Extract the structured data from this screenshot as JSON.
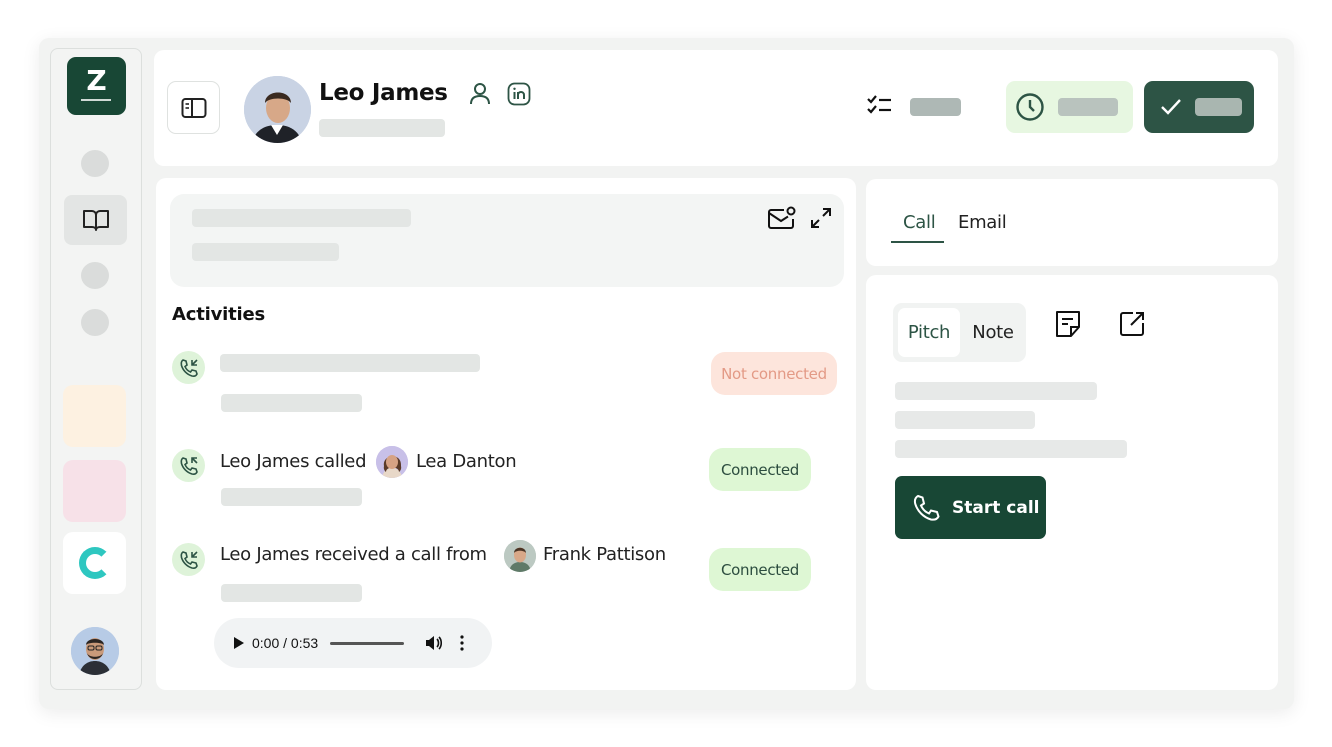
{
  "header": {
    "contact_name": "Leo James",
    "icons": [
      "sidebar-toggle-icon",
      "person-icon",
      "linkedin-icon",
      "tasks-icon",
      "clock-icon",
      "check-icon"
    ]
  },
  "sidebar": {
    "logo_letter": "Z",
    "items": [
      "book-icon",
      "peach-tile",
      "pink-tile",
      "ring-app-icon",
      "user-avatar"
    ]
  },
  "activities": {
    "title": "Activities",
    "items": [
      {
        "status": "Not connected"
      },
      {
        "text": "Leo James called",
        "contact": "Lea Danton",
        "status": "Connected"
      },
      {
        "text": "Leo James received a call from",
        "contact": "Frank Pattison",
        "status": "Connected",
        "audio": {
          "time": "0:00 / 0:53"
        }
      }
    ]
  },
  "tabs": {
    "call": "Call",
    "email": "Email"
  },
  "pitch": {
    "segment_pitch": "Pitch",
    "segment_note": "Note",
    "start_call": "Start call"
  },
  "colors": {
    "brand_dark": "#184735",
    "accent_green": "#2d5445",
    "connected_bg": "#def7d4",
    "not_connected_bg": "#fde5dc"
  }
}
